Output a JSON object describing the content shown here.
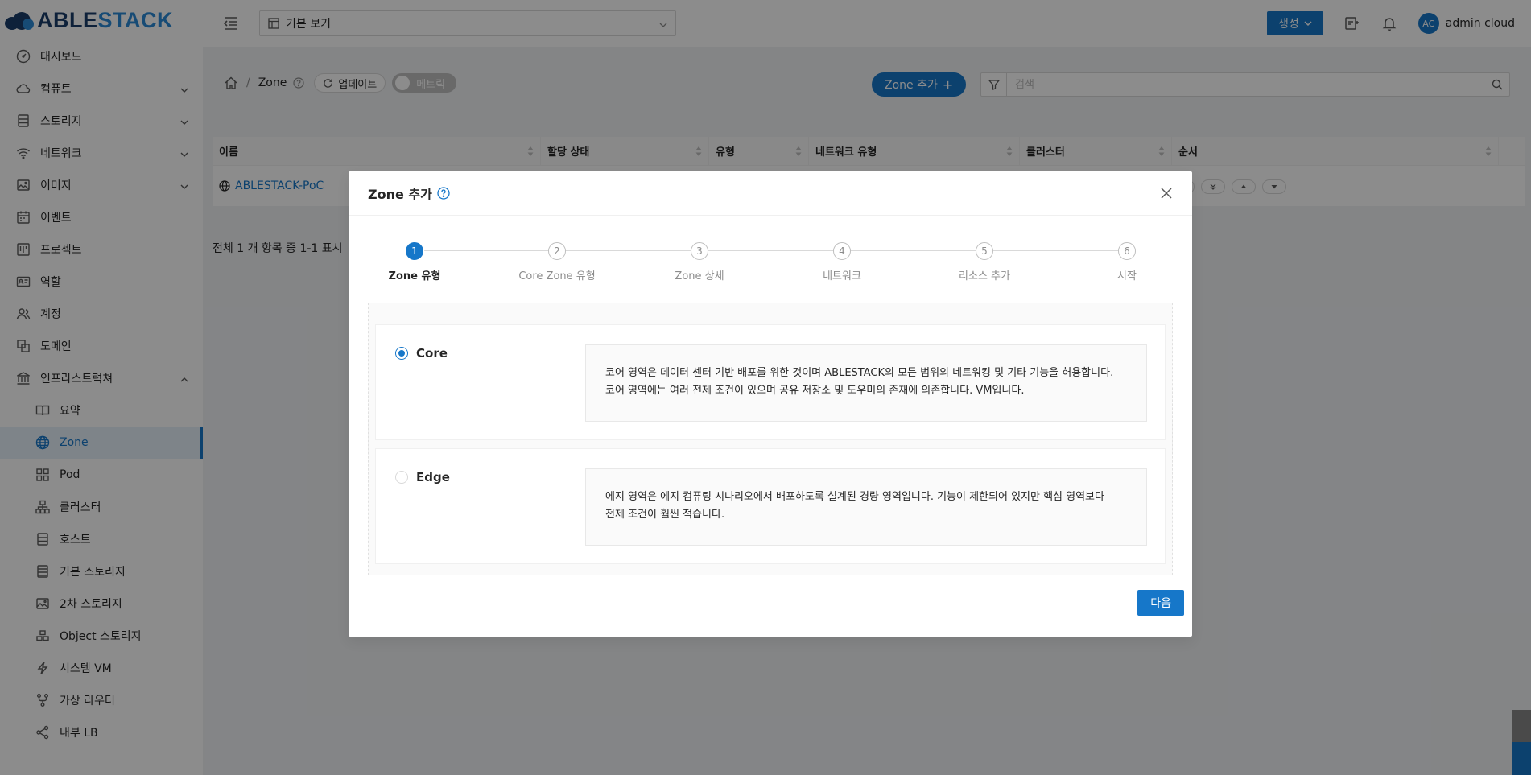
{
  "brand": {
    "logo_prefix": "ABLE",
    "logo_suffix": "STACK"
  },
  "sidebar": {
    "items": [
      {
        "label": "대시보드",
        "icon": "dashboard-icon"
      },
      {
        "label": "컴퓨트",
        "icon": "cloud-icon",
        "expandable": true
      },
      {
        "label": "스토리지",
        "icon": "database-icon",
        "expandable": true
      },
      {
        "label": "네트워크",
        "icon": "wifi-icon",
        "expandable": true
      },
      {
        "label": "이미지",
        "icon": "picture-icon",
        "expandable": true
      },
      {
        "label": "이벤트",
        "icon": "schedule-icon"
      },
      {
        "label": "프로젝트",
        "icon": "project-icon"
      },
      {
        "label": "역할",
        "icon": "idcard-icon"
      },
      {
        "label": "계정",
        "icon": "team-icon"
      },
      {
        "label": "도메인",
        "icon": "block-icon"
      },
      {
        "label": "인프라스트럭쳐",
        "icon": "bank-icon",
        "expanded": true
      }
    ],
    "sub_items": [
      {
        "label": "요약",
        "icon": "read-icon"
      },
      {
        "label": "Zone",
        "icon": "global-icon",
        "active": true
      },
      {
        "label": "Pod",
        "icon": "appstore-icon"
      },
      {
        "label": "클러스터",
        "icon": "cluster-icon"
      },
      {
        "label": "호스트",
        "icon": "database-icon"
      },
      {
        "label": "기본 스토리지",
        "icon": "hdd-icon"
      },
      {
        "label": "2차 스토리지",
        "icon": "picture-icon"
      },
      {
        "label": "Object 스토리지",
        "icon": "gold-icon"
      },
      {
        "label": "시스템 VM",
        "icon": "thunderbolt-icon"
      },
      {
        "label": "가상 라우터",
        "icon": "fork-icon"
      },
      {
        "label": "내부 LB",
        "icon": "share-icon"
      }
    ]
  },
  "header": {
    "view_select": "기본 보기",
    "create_label": "생성",
    "avatar_initials": "AC",
    "username": "admin cloud"
  },
  "toolbar": {
    "breadcrumb_current": "Zone",
    "refresh_label": "업데이트",
    "metric_label": "메트릭",
    "add_zone_label": "Zone 추가",
    "search_placeholder": "검색"
  },
  "table": {
    "columns": [
      "이름",
      "할당 상태",
      "유형",
      "네트워크 유형",
      "클러스터",
      "순서"
    ],
    "rows": [
      {
        "name": "ABLESTACK-PoC"
      }
    ],
    "footer": "전체 1 개 항목 중 1-1 표시"
  },
  "modal": {
    "title": "Zone 추가",
    "steps": [
      {
        "num": "1",
        "title": "Zone 유형",
        "active": true
      },
      {
        "num": "2",
        "title": "Core Zone 유형"
      },
      {
        "num": "3",
        "title": "Zone 상세"
      },
      {
        "num": "4",
        "title": "네트워크"
      },
      {
        "num": "5",
        "title": "리소스 추가"
      },
      {
        "num": "6",
        "title": "시작"
      }
    ],
    "options": [
      {
        "label": "Core",
        "checked": true,
        "description_line1": "코어 영역은 데이터 센터 기반 배포를 위한 것이며 ABLESTACK의 모든 범위의 네트워킹 및 기타 기능을 허용합니다.",
        "description_line2": "코어 영역에는 여러 전제 조건이 있으며 공유 저장소 및 도우미의 존재에 의존합니다. VM입니다."
      },
      {
        "label": "Edge",
        "checked": false,
        "description_line1": "에지 영역은 에지 컴퓨팅 시나리오에서 배포하도록 설계된 경량 영역입니다. 기능이 제한되어 있지만 핵심 영역보다",
        "description_line2": "전제 조건이 훨씬 적습니다."
      }
    ],
    "next_label": "다음"
  },
  "colors": {
    "primary": "#1677c9",
    "overlay": "rgba(0,0,0,0.45)"
  }
}
